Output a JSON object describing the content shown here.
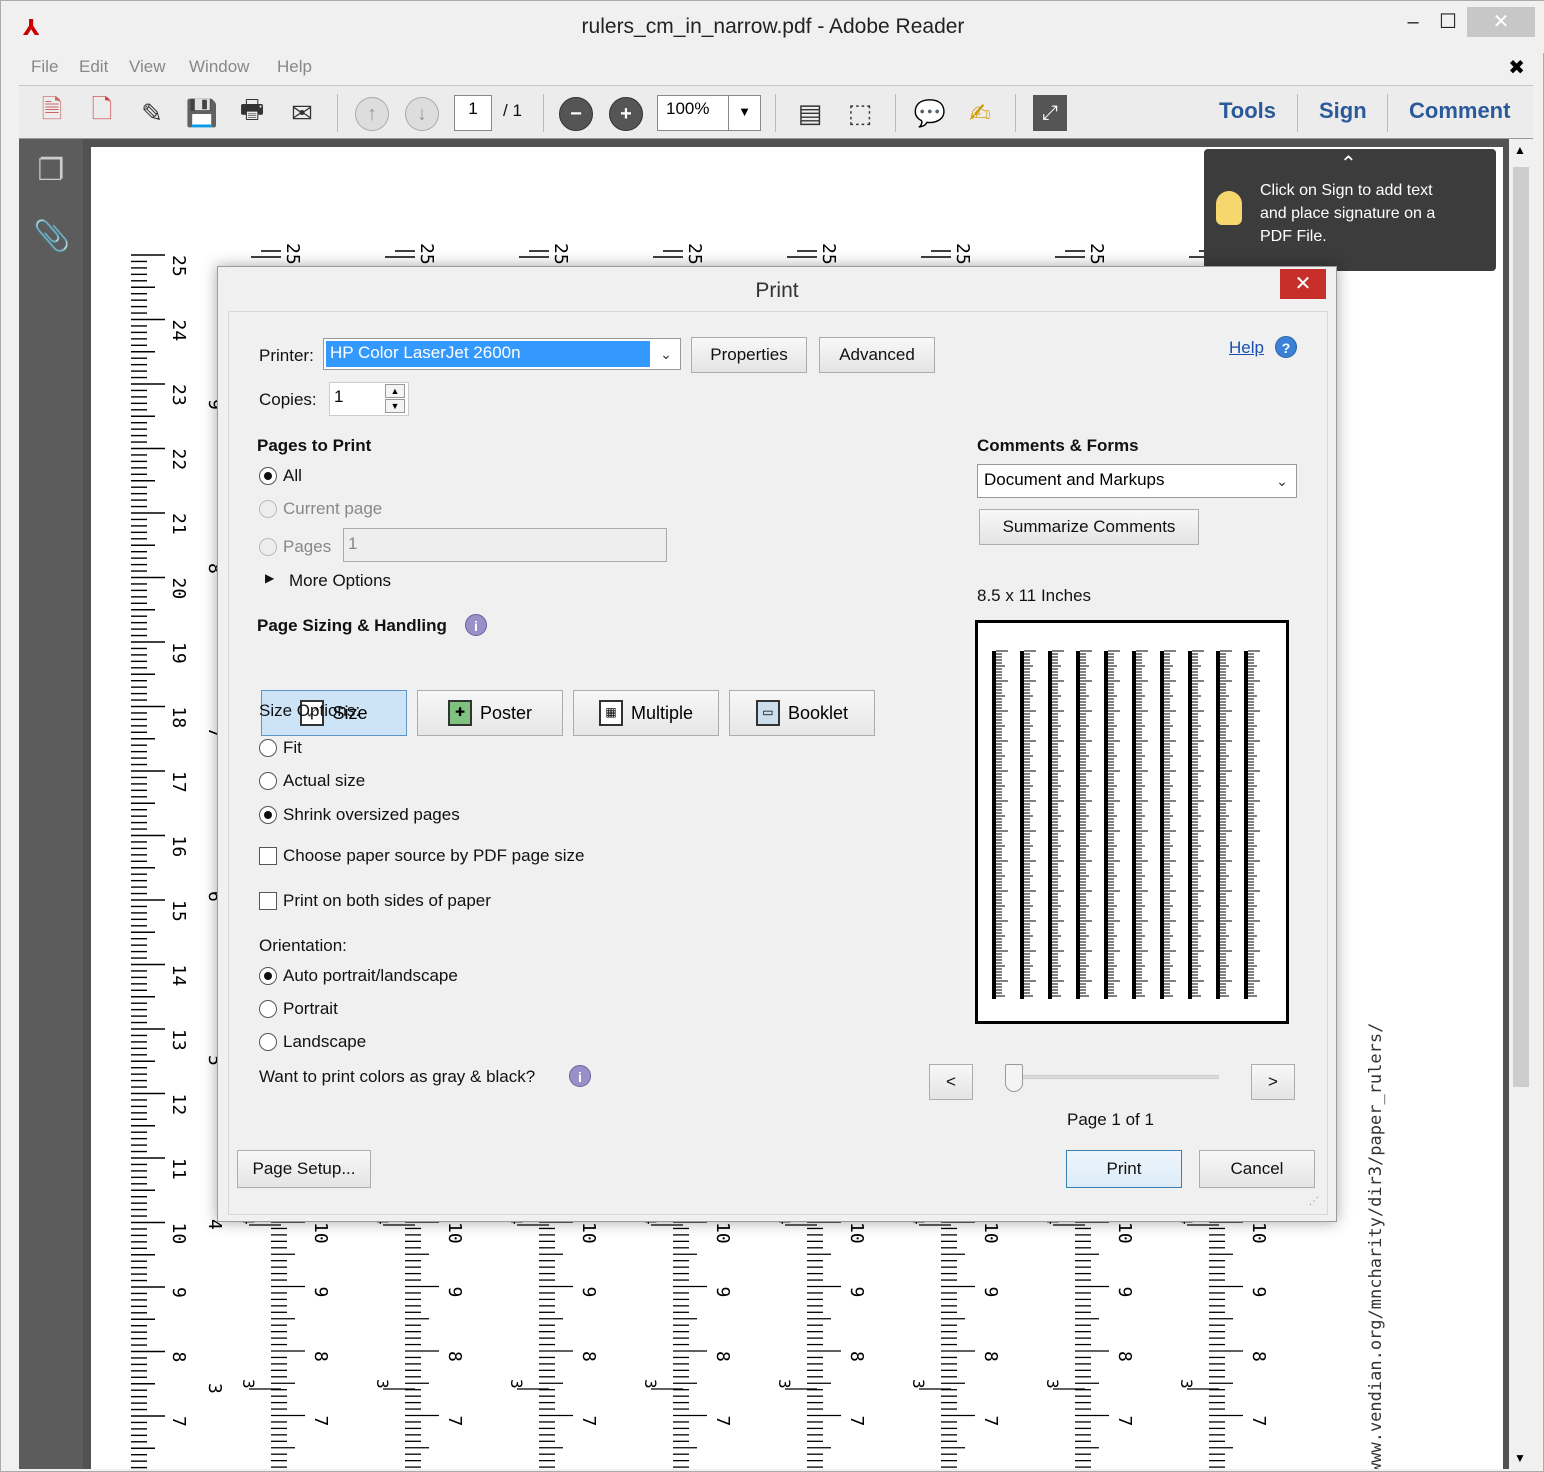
{
  "window": {
    "title": "rulers_cm_in_narrow.pdf - Adobe Reader",
    "minimize": "–",
    "maximize": "☐",
    "close": "✕"
  },
  "menu": [
    "File",
    "Edit",
    "View",
    "Window",
    "Help"
  ],
  "menu_close": "✖",
  "toolbar": {
    "page_current": "1",
    "page_total": "/ 1",
    "zoom": "100%",
    "tools": "Tools",
    "sign": "Sign",
    "comment": "Comment"
  },
  "tooltip": {
    "text_line1": "Click on Sign to add text",
    "text_line2": "and place signature on a",
    "text_line3": "PDF File.",
    "chevron": "⌃"
  },
  "document": {
    "ruler_labels_left": [
      "25",
      "24",
      "23",
      "22",
      "21",
      "20",
      "19",
      "18",
      "17",
      "16",
      "15",
      "14",
      "13",
      "12",
      "11",
      "10",
      "9",
      "8",
      "7"
    ],
    "inch_labels": [
      "9",
      "8",
      "7",
      "6",
      "5",
      "4",
      "3"
    ],
    "column_top_label": "25",
    "column_bottom_labels": [
      "10",
      "9",
      "8",
      "7"
    ],
    "column_inch_labels": [
      "4",
      "3"
    ],
    "url": "www.vendian.org/mncharity/dir3/paper_rulers/"
  },
  "dialog": {
    "title": "Print",
    "close": "✕",
    "printer_label": "Printer:",
    "printer_value": "HP Color LaserJet 2600n",
    "properties_button": "Properties",
    "advanced_button": "Advanced",
    "help_link": "Help",
    "copies_label": "Copies:",
    "copies_value": "1",
    "pages_to_print_heading": "Pages to Print",
    "option_all": "All",
    "option_current_page": "Current page",
    "option_pages": "Pages",
    "pages_value": "1",
    "more_options": "More Options",
    "page_sizing_heading": "Page Sizing & Handling",
    "seg_size": "Size",
    "seg_poster": "Poster",
    "seg_multiple": "Multiple",
    "seg_booklet": "Booklet",
    "size_options_label": "Size Options:",
    "size_fit": "Fit",
    "size_actual": "Actual size",
    "size_shrink": "Shrink oversized pages",
    "choose_paper_source": "Choose paper source by PDF page size",
    "print_both_sides": "Print on both sides of paper",
    "orientation_label": "Orientation:",
    "orient_auto": "Auto portrait/landscape",
    "orient_portrait": "Portrait",
    "orient_landscape": "Landscape",
    "gray_question": "Want to print colors as gray & black?",
    "comments_forms_heading": "Comments & Forms",
    "comments_forms_value": "Document and Markups",
    "summarize_button": "Summarize Comments",
    "paper_size": "8.5 x 11 Inches",
    "prev_button": "<",
    "next_button": ">",
    "page_indicator": "Page 1 of 1",
    "page_setup_button": "Page Setup...",
    "print_button": "Print",
    "cancel_button": "Cancel"
  },
  "colors": {
    "accent_blue": "#2a5a9a",
    "selection_blue": "#3399ff",
    "close_red": "#c7302a",
    "tooltip_bg": "#3c3c3c",
    "panel_dark": "#5c5c5c"
  }
}
